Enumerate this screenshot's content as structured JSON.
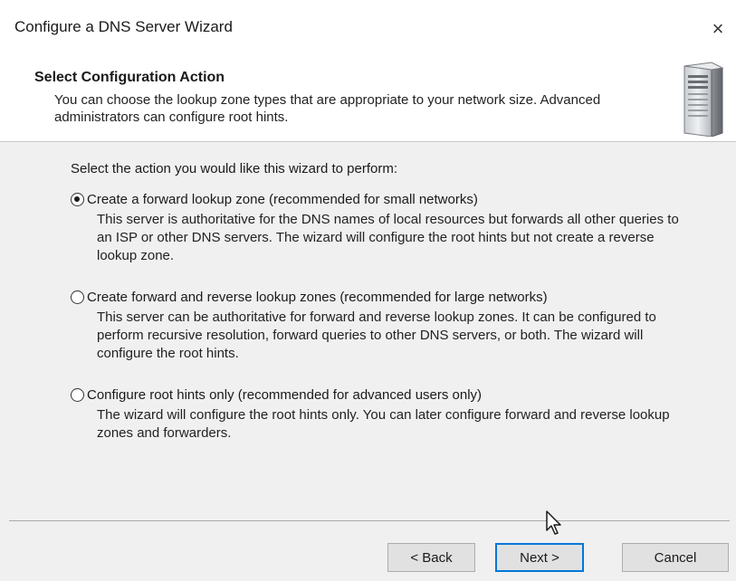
{
  "window": {
    "title": "Configure a DNS Server Wizard",
    "close_glyph": "×"
  },
  "header": {
    "title": "Select Configuration Action",
    "description": "You can choose the lookup zone types that are appropriate to your network size. Advanced administrators can configure root hints.",
    "icon": "server-icon"
  },
  "body": {
    "prompt": "Select the action you would like this wizard to perform:",
    "selected_option": "forward-lookup-zone",
    "options": [
      {
        "id": "forward-lookup-zone",
        "label": "Create a forward lookup zone (recommended for small networks)",
        "description": "This server is authoritative for the DNS names of local resources but forwards all other queries to an ISP or other DNS servers. The wizard will configure the root hints but not create a reverse lookup zone.",
        "checked": true
      },
      {
        "id": "forward-and-reverse",
        "label": "Create forward and reverse lookup zones (recommended for large networks)",
        "description": "This server can be authoritative for forward and reverse lookup zones. It can be configured to perform recursive resolution, forward queries to other DNS servers, or both. The wizard will configure the root hints.",
        "checked": false
      },
      {
        "id": "root-hints-only",
        "label": "Configure root hints only (recommended for advanced users only)",
        "description": "The wizard will configure the root hints only. You can later configure forward and reverse lookup zones and forwarders.",
        "checked": false
      }
    ]
  },
  "footer": {
    "back_label": "< Back",
    "next_label": "Next >",
    "cancel_label": "Cancel"
  },
  "colors": {
    "focus_border": "#0078d7",
    "button_face": "#e1e1e1",
    "dialog_background": "#f0f0f0"
  }
}
